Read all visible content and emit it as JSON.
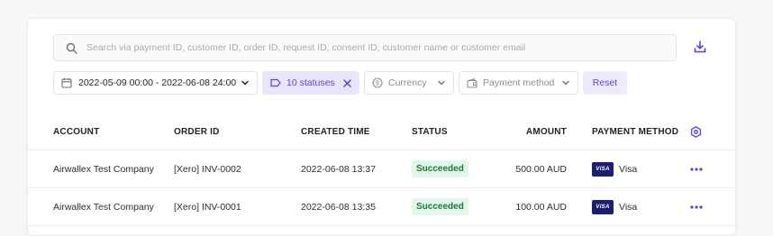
{
  "search": {
    "placeholder": "Search via payment ID, customer ID, order ID, request ID, consent ID, customer name or customer email",
    "icon": "search-icon",
    "download_icon": "download-icon"
  },
  "filters": {
    "date_range": "2022-05-09 00:00 - 2022-06-08 24:00",
    "statuses": "10 statuses",
    "currency": "Currency",
    "payment_method": "Payment method",
    "reset": "Reset"
  },
  "table": {
    "headers": {
      "account": "ACCOUNT",
      "order_id": "ORDER ID",
      "created_time": "CREATED TIME",
      "status": "STATUS",
      "amount": "AMOUNT",
      "payment_method": "PAYMENT METHOD"
    },
    "rows": [
      {
        "account": "Airwallex Test Company",
        "order_id": "[Xero] INV-0002",
        "created_time": "2022-06-08 13:37",
        "status": "Succeeded",
        "amount": "500.00 AUD",
        "card_brand": "VISA",
        "payment_method": "Visa"
      },
      {
        "account": "Airwallex Test Company",
        "order_id": "[Xero] INV-0001",
        "created_time": "2022-06-08 13:35",
        "status": "Succeeded",
        "amount": "100.00 AUD",
        "card_brand": "VISA",
        "payment_method": "Visa"
      }
    ]
  },
  "colors": {
    "accent": "#5b3fd6",
    "status_success_bg": "#e3f6ea",
    "status_success_text": "#1a7a3e",
    "visa_blue": "#1a1f71"
  }
}
